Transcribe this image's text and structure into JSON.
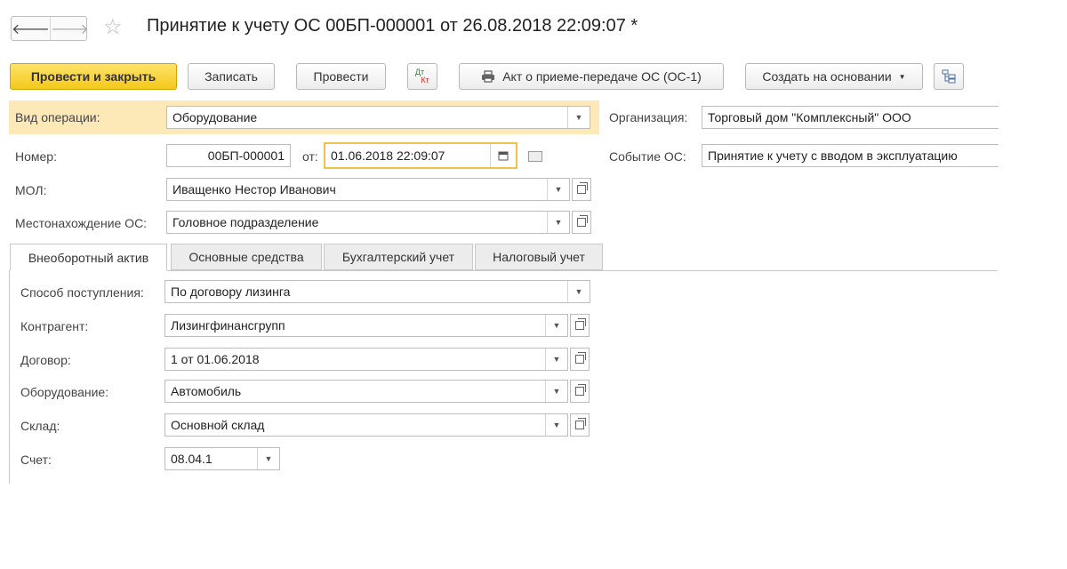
{
  "nav": {
    "back": "🡐",
    "forward": "🡒"
  },
  "title": "Принятие к учету ОС 00БП-000001 от 26.08.2018 22:09:07 *",
  "toolbar": {
    "post_close": "Провести и закрыть",
    "save": "Записать",
    "post": "Провести",
    "dtkt_top": "Дт",
    "dtkt_bottom": "Кт",
    "act": "Акт о приеме-передаче ОС (ОС-1)",
    "create_based": "Создать на основании"
  },
  "header": {
    "op_type_label": "Вид операции:",
    "op_type_value": "Оборудование",
    "org_label": "Организация:",
    "org_value": "Торговый дом \"Комплексный\" ООО",
    "number_label": "Номер:",
    "number_value": "00БП-000001",
    "date_label": "от:",
    "date_value": "01.06.2018 22:09:07",
    "event_label": "Событие ОС:",
    "event_value": "Принятие к учету с вводом в эксплуатацию",
    "mol_label": "МОЛ:",
    "mol_value": "Иващенко Нестор Иванович",
    "location_label": "Местонахождение ОС:",
    "location_value": "Головное подразделение"
  },
  "tabs": [
    "Внеоборотный актив",
    "Основные средства",
    "Бухгалтерский учет",
    "Налоговый учет"
  ],
  "asset": {
    "receipt_label": "Способ поступления:",
    "receipt_value": "По договору лизинга",
    "counterparty_label": "Контрагент:",
    "counterparty_value": "Лизингфинансгрупп",
    "contract_label": "Договор:",
    "contract_value": "1 от 01.06.2018",
    "equipment_label": "Оборудование:",
    "equipment_value": "Автомобиль",
    "warehouse_label": "Склад:",
    "warehouse_value": "Основной склад",
    "account_label": "Счет:",
    "account_value": "08.04.1"
  }
}
